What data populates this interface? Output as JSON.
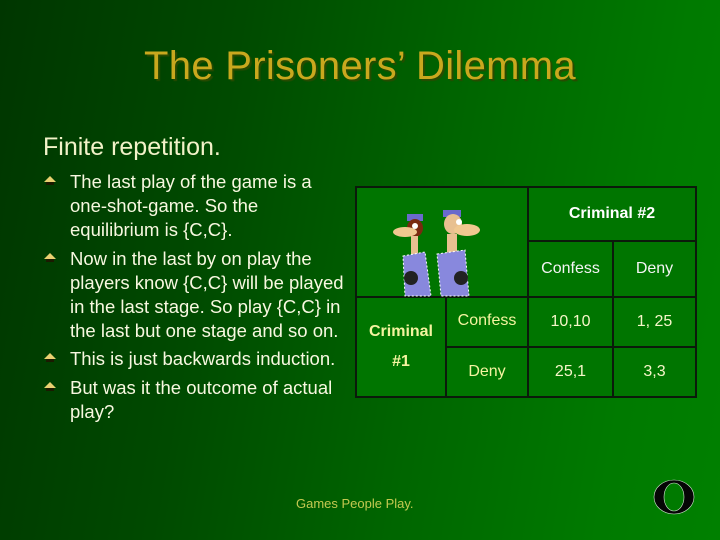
{
  "slide": {
    "title": "The Prisoners’ Dilemma",
    "subtitle": "Finite repetition.",
    "bullets": [
      "The last play of the game is a one-shot-game. So the equilibrium is {C,C}.",
      "Now in the last by on play the players know {C,C} will be played in the last stage. So play {C,C} in the last but one stage and so on.",
      "This is just backwards induction.",
      "But was it the outcome of actual play?"
    ],
    "bullet_icon": "diamond-bullet-icon",
    "footer": "Games People Play.",
    "logo_letter": "O"
  },
  "payoff_table": {
    "illustration": "two-prisoners-cartoon",
    "column_player": "Criminal #2",
    "row_player_line1": "Criminal",
    "row_player_line2": "#1",
    "column_strategies": [
      "Confess",
      "Deny"
    ],
    "row_strategies": [
      "Confess",
      "Deny"
    ],
    "payoffs": [
      [
        "10,10",
        "1, 25"
      ],
      [
        "25,1",
        "3,3"
      ]
    ]
  },
  "colors": {
    "title": "#c9a81e",
    "background_dark": "#003600",
    "background_light": "#008000",
    "table_fill": "#007500"
  }
}
